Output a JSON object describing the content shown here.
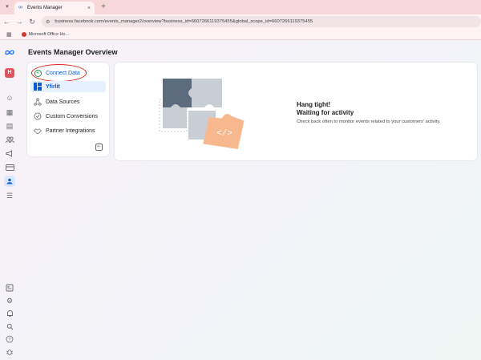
{
  "browser": {
    "tab_title": "Events Manager",
    "url": "business.facebook.com/events_manager2/overview?business_id=6607266119375455&global_scope_id=6607266119375455",
    "bookmark_label": "Microsoft Office Ho..."
  },
  "rail": {
    "avatar_letter": "H",
    "icons": [
      "meta-logo-icon",
      "smiley-icon",
      "grid-table-icon",
      "document-icon",
      "people-icon",
      "megaphone-icon",
      "credit-card-icon",
      "events-manager-icon",
      "menu-icon",
      "report-icon",
      "settings-icon",
      "bell-icon",
      "search-icon",
      "help-icon",
      "bug-icon"
    ]
  },
  "page": {
    "title": "Events Manager Overview"
  },
  "nav": {
    "connect_data": "Connect Data",
    "pixel_name": "Yfirlit",
    "data_sources": "Data Sources",
    "custom_conversions": "Custom Conversions",
    "partner_integrations": "Partner Integrations"
  },
  "empty_state": {
    "title": "Hang tight!",
    "subtitle": "Waiting for activity",
    "body": "Check back often to monitor events related to your customers' activity."
  },
  "colors": {
    "accent": "#0a5ad6",
    "highlight_circle": "#e0201e",
    "puzzle_dark": "#5d6b7e",
    "puzzle_light": "#c7ccd3",
    "puzzle_orange": "#f7b88e"
  }
}
